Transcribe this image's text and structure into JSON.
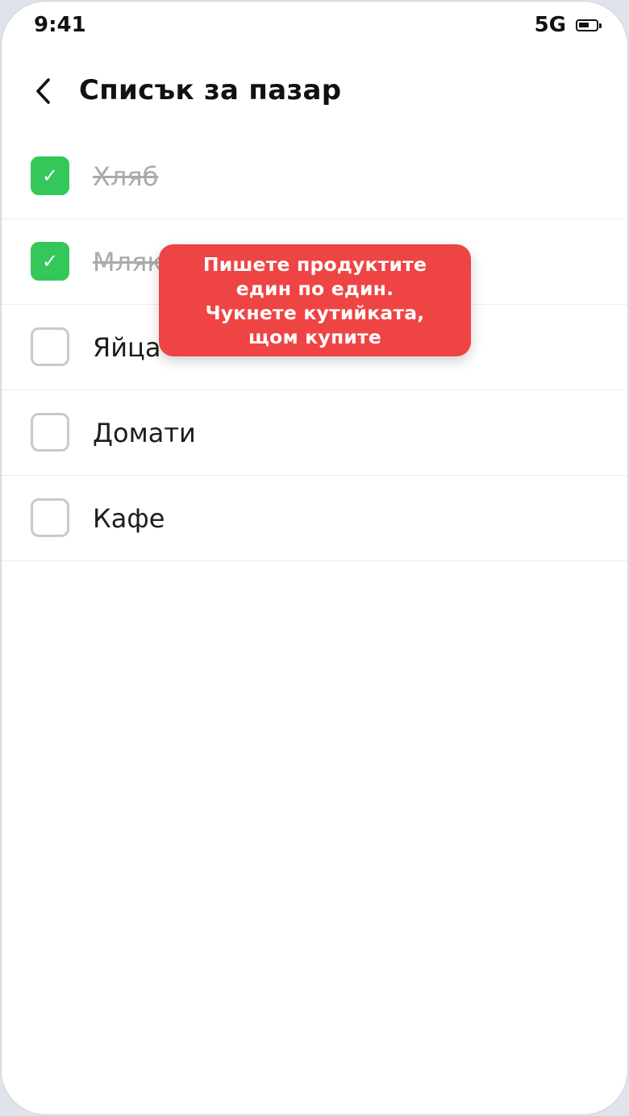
{
  "status_bar": {
    "time": "9:41",
    "network": "5G",
    "battery_icon": "battery-icon"
  },
  "header": {
    "back_icon": "chevron-left-icon",
    "title": "Списък за пазар"
  },
  "items": [
    {
      "label": "Хляб",
      "checked": true
    },
    {
      "label": "Мляко",
      "checked": true
    },
    {
      "label": "Яйца",
      "checked": false
    },
    {
      "label": "Домати",
      "checked": false
    },
    {
      "label": "Кафе",
      "checked": false
    }
  ],
  "tooltip": {
    "lines": [
      "Пишете продуктите",
      "един по един.",
      "Чукнете кутийката,",
      "щом купите"
    ]
  },
  "colors": {
    "accent_checked": "#34c759",
    "tooltip_bg": "#ef4444",
    "checked_text": "#aaaaaa"
  }
}
